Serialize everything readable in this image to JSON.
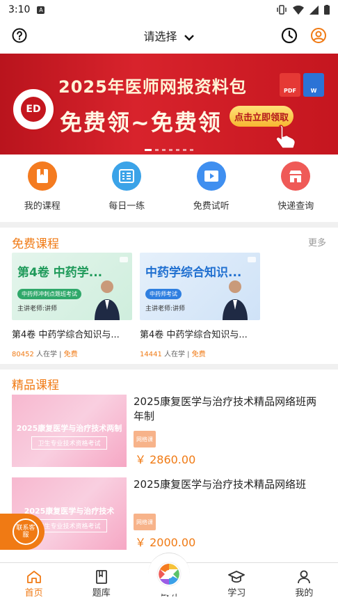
{
  "status_bar": {
    "time": "3:10",
    "notification_glyph": "A"
  },
  "header": {
    "title": "请选择",
    "help_icon": "question-circle",
    "history_icon": "clock",
    "profile_icon": "user"
  },
  "banner": {
    "line1": "2025年医师网报资料包",
    "line2": "免费领~免费领",
    "button": "点击立即领取",
    "doc1": "PDF",
    "doc2": "W",
    "slide_count": 7,
    "active_slide": 1
  },
  "quick": [
    {
      "label": "我的课程",
      "icon": "book-icon",
      "color": "#f47b20"
    },
    {
      "label": "每日一练",
      "icon": "checklist-icon",
      "color": "#3ba3e8"
    },
    {
      "label": "免费试听",
      "icon": "video-icon",
      "color": "#3f8ff0"
    },
    {
      "label": "快递查询",
      "icon": "store-icon",
      "color": "#ef5a57"
    }
  ],
  "free_section": {
    "title": "免费课程",
    "more": "更多"
  },
  "free_courses": [
    {
      "thumb_title": "第4卷 中药学...",
      "pill": "中药师冲刺点题班考试",
      "lecturer": "主讲老师:讲师",
      "name": "第4卷 中药学综合知识与...",
      "learners": "80452",
      "learners_label": "人在学",
      "price_label": "免费"
    },
    {
      "thumb_title": "中药学综合知识...",
      "pill": "中药师考试",
      "lecturer": "主讲老师:讲师",
      "name": "第4卷 中药学综合知识与...",
      "learners": "14441",
      "learners_label": "人在学",
      "price_label": "免费"
    }
  ],
  "premium_section": {
    "title": "精品课程"
  },
  "premium_courses": [
    {
      "thumb_title": "2025康复医学与治疗技术两制",
      "thumb_sub": "卫生专业技术资格考试",
      "title": "2025康复医学与治疗技术精品网络班两年制",
      "badge": "网络课",
      "price": "￥ 2860.00"
    },
    {
      "thumb_title": "2025康复医学与治疗技术",
      "thumb_sub": "卫生专业技术资格考试",
      "title": "2025康复医学与治疗技术精品网络班",
      "badge": "网络课",
      "price": "￥ 2000.00"
    }
  ],
  "service": {
    "label": "联系客服"
  },
  "tabs": [
    {
      "label": "首页",
      "icon": "home-icon",
      "active": true
    },
    {
      "label": "题库",
      "icon": "question-bank-icon",
      "active": false
    },
    {
      "label": "试听",
      "icon": "aperture-icon",
      "active": false
    },
    {
      "label": "学习",
      "icon": "graduation-cap-icon",
      "active": false
    },
    {
      "label": "我的",
      "icon": "person-icon",
      "active": false
    }
  ],
  "colors": {
    "accent": "#f07a14",
    "banner_red": "#c5161f"
  }
}
